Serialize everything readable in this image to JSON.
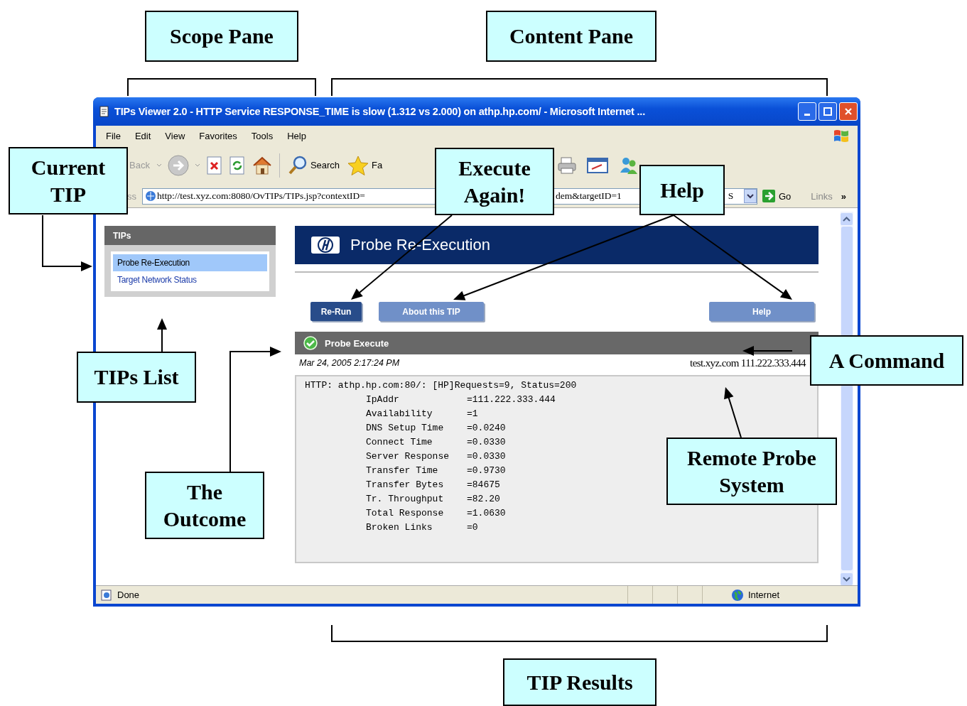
{
  "annotations": [
    {
      "text": "Scope Pane"
    },
    {
      "text": "Content Pane"
    },
    {
      "text": "Current TIP"
    },
    {
      "text": "Execute Again!"
    },
    {
      "text": "Help"
    },
    {
      "text": "A Command"
    },
    {
      "text": "TIPs List"
    },
    {
      "text": "The Outcome"
    },
    {
      "text": "Remote Probe System"
    },
    {
      "text": "TIP Results"
    }
  ],
  "window": {
    "title": "TIPs Viewer 2.0 - HTTP Service RESPONSE_TIME is slow (1.312 vs 2.000) on athp.hp.com/ - Microsoft Internet ...",
    "menu": [
      "File",
      "Edit",
      "View",
      "Favorites",
      "Tools",
      "Help"
    ],
    "toolbar": {
      "back_label": "Back",
      "search_label": "Search",
      "favorites_label": "Fa"
    },
    "address": {
      "label": "ss",
      "url_parts": [
        "http://test.xyz.com:8080/OvTIPs/TIPs.jsp?contextID=",
        "dem&targetID=1",
        "S"
      ],
      "go_label": "Go",
      "links_label": "Links",
      "chevron": "»"
    },
    "status_bar": {
      "text": "Done",
      "zone": "Internet"
    }
  },
  "sidebar": {
    "title": "TIPs",
    "items": [
      {
        "label": "Probe Re-Execution",
        "selected": true
      },
      {
        "label": "Target Network Status",
        "selected": false
      }
    ]
  },
  "content": {
    "banner_title": "Probe Re-Execution",
    "buttons": [
      {
        "label": "Re-Run",
        "kind": "primary"
      },
      {
        "label": "About this TIP",
        "kind": "secondary"
      }
    ],
    "help_button": "Help",
    "section_title": "Probe Execute",
    "timestamp": "Mar 24, 2005 2:17:24 PM",
    "target": "test.xyz.com 111.222.333.444",
    "output": {
      "header": "HTTP: athp.hp.com:80/: [HP]Requests=9, Status=200",
      "rows": [
        {
          "name": "IpAddr",
          "value": "=111.222.333.444"
        },
        {
          "name": "Availability",
          "value": "=1"
        },
        {
          "name": "DNS Setup Time",
          "value": "=0.0240"
        },
        {
          "name": "Connect Time",
          "value": "=0.0330"
        },
        {
          "name": "Server Response",
          "value": "=0.0330"
        },
        {
          "name": "Transfer Time",
          "value": "=0.9730"
        },
        {
          "name": "Transfer Bytes",
          "value": "=84675"
        },
        {
          "name": "Tr. Throughput",
          "value": "=82.20"
        },
        {
          "name": "Total Response",
          "value": "=1.0630"
        },
        {
          "name": "Broken Links",
          "value": "=0"
        }
      ]
    }
  }
}
